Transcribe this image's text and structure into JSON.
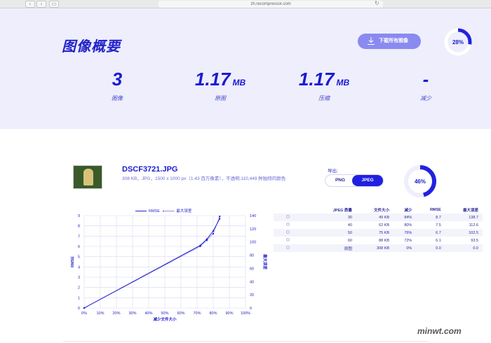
{
  "browser": {
    "url": "zh.recompressor.com",
    "back": "‹",
    "forward": "›"
  },
  "summary": {
    "title": "图像概要",
    "download_label": "下载所有图像",
    "ring_percent": 0.28,
    "ring_label": "28%",
    "stats": [
      {
        "value": "3",
        "unit": "",
        "label": "图像"
      },
      {
        "value": "1.17",
        "unit": "MB",
        "label": "原图"
      },
      {
        "value": "1.17",
        "unit": "MB",
        "label": "压缩"
      },
      {
        "value": "-",
        "unit": "",
        "label": "减少"
      }
    ]
  },
  "file": {
    "name": "DSCF3721.JPG",
    "meta": "308 KB，JPG，1500 x 1000 px（1.43 百万像素），不透明,110,449 种独特的颜色",
    "export_label": "导出:",
    "formats": [
      "PNG",
      "JPEG"
    ],
    "selected_format": "JPEG",
    "ring_percent": 0.46,
    "ring_label": "46%"
  },
  "legend": {
    "rmse": "RMSE",
    "max": "最大误差"
  },
  "table": {
    "headers": [
      "",
      "JPEG 质量",
      "文件大小",
      "减少",
      "RMSE",
      "最大误差"
    ],
    "rows": [
      [
        "30",
        "49 KB",
        "84%",
        "8.7",
        "138.7"
      ],
      [
        "40",
        "62 KB",
        "80%",
        "7.5",
        "112.6"
      ],
      [
        "50",
        "75 KB",
        "76%",
        "6.7",
        "102.5"
      ],
      [
        "60",
        "88 KB",
        "72%",
        "6.1",
        "93.5"
      ],
      [
        "原图",
        "308 KB",
        "0%",
        "0.0",
        "0.0"
      ]
    ]
  },
  "chart_data": {
    "type": "line",
    "xlabel": "减少文件大小",
    "ylabel": "RMSE",
    "y2label": "最大误差",
    "xlim": [
      0,
      100
    ],
    "ylim": [
      0,
      9
    ],
    "y2lim": [
      0,
      140
    ],
    "xticks": [
      "0%",
      "10%",
      "20%",
      "30%",
      "40%",
      "50%",
      "60%",
      "70%",
      "80%",
      "90%",
      "100%"
    ],
    "yticks": [
      "0",
      "1",
      "2",
      "3",
      "4",
      "5",
      "6",
      "7",
      "8",
      "9"
    ],
    "y2ticks": [
      "0",
      "20",
      "40",
      "60",
      "80",
      "100",
      "120",
      "140"
    ],
    "grid": true,
    "series": [
      {
        "name": "RMSE",
        "x": [
          0,
          72,
          76,
          80,
          84
        ],
        "y": [
          0,
          6.1,
          6.7,
          7.5,
          8.7
        ]
      },
      {
        "name": "最大误差",
        "x": [
          0,
          72,
          76,
          80,
          84
        ],
        "y": [
          0,
          93.5,
          102.5,
          112.6,
          138.7
        ]
      }
    ],
    "colors": {
      "line": "#2222cc",
      "grid": "#d8d8f4"
    }
  },
  "watermark": "minwt.com"
}
